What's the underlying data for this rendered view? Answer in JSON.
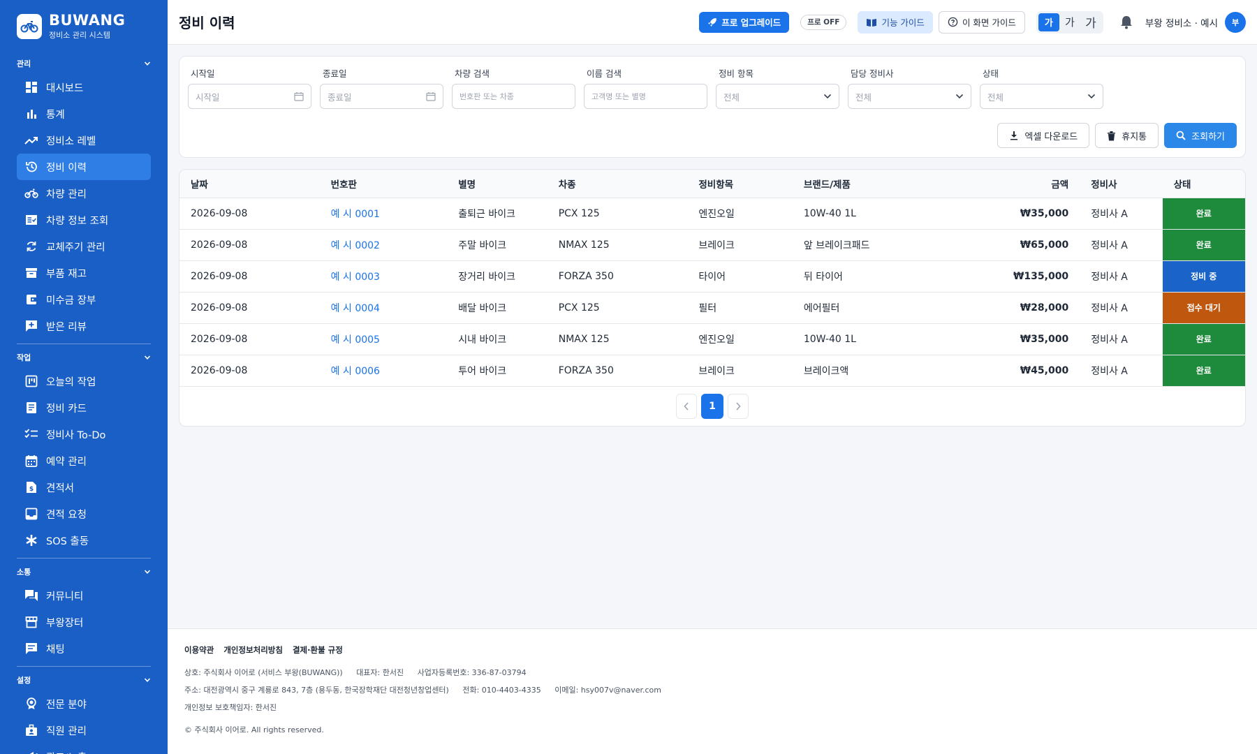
{
  "brand": {
    "name": "BUWANG",
    "subtitle": "정비소 관리 시스템"
  },
  "sidebar": {
    "sections": [
      {
        "title": "관리",
        "items": [
          {
            "label": "대시보드",
            "icon": "dashboard-icon"
          },
          {
            "label": "통계",
            "icon": "bar-chart-icon"
          },
          {
            "label": "정비소 레벨",
            "icon": "trending-up-icon"
          },
          {
            "label": "정비 이력",
            "icon": "history-icon",
            "active": true
          },
          {
            "label": "차량 관리",
            "icon": "motorcycle-icon"
          },
          {
            "label": "차량 정보 조회",
            "icon": "fact-check-icon"
          },
          {
            "label": "교체주기 관리",
            "icon": "cycle-icon"
          },
          {
            "label": "부품 재고",
            "icon": "inventory-icon"
          },
          {
            "label": "미수금 장부",
            "icon": "ledger-icon"
          },
          {
            "label": "받은 리뷰",
            "icon": "review-icon"
          }
        ]
      },
      {
        "title": "작업",
        "items": [
          {
            "label": "오늘의 작업",
            "icon": "today-icon"
          },
          {
            "label": "정비 카드",
            "icon": "card-icon"
          },
          {
            "label": "정비사 To-Do",
            "icon": "checklist-icon"
          },
          {
            "label": "예약 관리",
            "icon": "calendar-icon"
          },
          {
            "label": "견적서",
            "icon": "estimate-icon"
          },
          {
            "label": "견적 요청",
            "icon": "inbox-icon"
          },
          {
            "label": "SOS 출동",
            "icon": "asterisk-icon"
          }
        ]
      },
      {
        "title": "소통",
        "items": [
          {
            "label": "커뮤니티",
            "icon": "forum-icon"
          },
          {
            "label": "부왕장터",
            "icon": "store-icon"
          },
          {
            "label": "채팅",
            "icon": "chat-icon"
          }
        ]
      },
      {
        "title": "설정",
        "items": [
          {
            "label": "전문 분야",
            "icon": "badge-icon"
          },
          {
            "label": "직원 관리",
            "icon": "staff-icon"
          },
          {
            "label": "광고/노출",
            "icon": "megaphone-icon"
          }
        ]
      }
    ]
  },
  "header": {
    "title": "정비 이력",
    "pro_upgrade": "프로 업그레이드",
    "pro_status": "프로 OFF",
    "feature_guide": "기능 가이드",
    "screen_guide": "이 화면 가이드",
    "font_sizes": [
      "가",
      "가",
      "가"
    ],
    "user": "부왕 정비소 · 예시",
    "avatar": "부"
  },
  "filters": [
    {
      "label": "시작일",
      "placeholder": "시작일",
      "type": "date"
    },
    {
      "label": "종료일",
      "placeholder": "종료일",
      "type": "date"
    },
    {
      "label": "차량 검색",
      "placeholder": "번호판 또는 차종",
      "type": "text"
    },
    {
      "label": "이름 검색",
      "placeholder": "고객명 또는 별명",
      "type": "text"
    },
    {
      "label": "정비 항목",
      "placeholder": "전체",
      "type": "select"
    },
    {
      "label": "담당 정비사",
      "placeholder": "전체",
      "type": "select"
    },
    {
      "label": "상태",
      "placeholder": "전체",
      "type": "select"
    }
  ],
  "actions": {
    "excel": "엑셀 다운로드",
    "trash": "휴지통",
    "search": "조회하기"
  },
  "table": {
    "columns": [
      "날짜",
      "번호판",
      "별명",
      "차종",
      "정비항목",
      "브랜드/제품",
      "금액",
      "정비사",
      "상태"
    ],
    "rows": [
      {
        "date": "2026-09-08",
        "plate": "예 시 0001",
        "nickname": "출퇴근 바이크",
        "model": "PCX 125",
        "item": "엔진오일",
        "product": "10W-40 1L",
        "amount": "₩35,000",
        "mechanic": "정비사 A",
        "status": "완료"
      },
      {
        "date": "2026-09-08",
        "plate": "예 시 0002",
        "nickname": "주말 바이크",
        "model": "NMAX 125",
        "item": "브레이크",
        "product": "앞 브레이크패드",
        "amount": "₩65,000",
        "mechanic": "정비사 A",
        "status": "완료"
      },
      {
        "date": "2026-09-08",
        "plate": "예 시 0003",
        "nickname": "장거리 바이크",
        "model": "FORZA 350",
        "item": "타이어",
        "product": "뒤 타이어",
        "amount": "₩135,000",
        "mechanic": "정비사 A",
        "status": "정비 중"
      },
      {
        "date": "2026-09-08",
        "plate": "예 시 0004",
        "nickname": "배달 바이크",
        "model": "PCX 125",
        "item": "필터",
        "product": "에어필터",
        "amount": "₩28,000",
        "mechanic": "정비사 A",
        "status": "접수 대기"
      },
      {
        "date": "2026-09-08",
        "plate": "예 시 0005",
        "nickname": "시내 바이크",
        "model": "NMAX 125",
        "item": "엔진오일",
        "product": "10W-40 1L",
        "amount": "₩35,000",
        "mechanic": "정비사 A",
        "status": "완료"
      },
      {
        "date": "2026-09-08",
        "plate": "예 시 0006",
        "nickname": "투어 바이크",
        "model": "FORZA 350",
        "item": "브레이크",
        "product": "브레이크액",
        "amount": "₩45,000",
        "mechanic": "정비사 A",
        "status": "완료"
      }
    ],
    "status_colors": {
      "완료": "#1e8a3c",
      "정비 중": "#1a63c9",
      "접수 대기": "#c0570f"
    }
  },
  "pagination": {
    "current": "1"
  },
  "footer": {
    "links": [
      "이용약관",
      "개인정보처리방침",
      "결제·환불 규정"
    ],
    "company": "상호: 주식회사 이어로 (서비스 부왕(BUWANG))",
    "ceo": "대표자: 한서진",
    "biz_no": "사업자등록번호: 336-87-03794",
    "address": "주소: 대전광역시 중구 계룡로 843, 7층 (용두동, 한국장학재단 대전청년창업센터)",
    "phone": "전화: 010-4403-4335",
    "email": "이메일: hsy007v@naver.com",
    "privacy_officer": "개인정보 보호책임자: 한서진",
    "copyright": "© 주식회사 이어로. All rights reserved."
  }
}
